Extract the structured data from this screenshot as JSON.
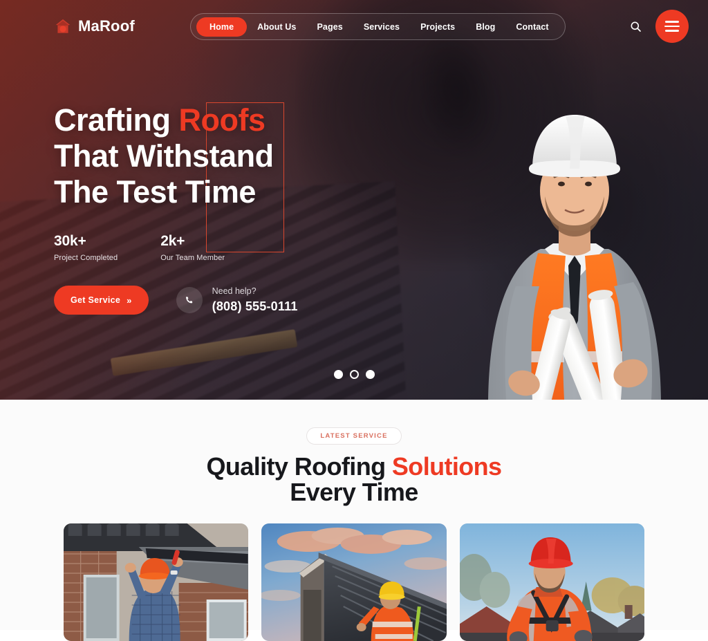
{
  "brand": {
    "name": "MaRoof",
    "icon": "home-roof-icon"
  },
  "nav": {
    "items": [
      {
        "label": "Home",
        "active": true
      },
      {
        "label": "About Us",
        "active": false
      },
      {
        "label": "Pages",
        "active": false
      },
      {
        "label": "Services",
        "active": false
      },
      {
        "label": "Projects",
        "active": false
      },
      {
        "label": "Blog",
        "active": false
      },
      {
        "label": "Contact",
        "active": false
      }
    ],
    "search_icon": "search-icon",
    "menu_icon": "hamburger-menu-icon"
  },
  "hero": {
    "title_line1_a": "Crafting ",
    "title_line1_b": "Roofs",
    "title_line2": "That Withstand",
    "title_line3": "The Test Time",
    "stats": [
      {
        "value": "30k+",
        "label": "Project Completed"
      },
      {
        "value": "2k+",
        "label": "Our Team Member"
      }
    ],
    "cta_label": "Get Service",
    "cta_chevron": "»",
    "phone_icon": "phone-icon",
    "need_help": "Need help?",
    "phone_number": "(808) 555-0111",
    "slides": [
      {
        "state": "filled"
      },
      {
        "state": "ring"
      },
      {
        "state": "filled"
      }
    ],
    "image_alt": "engineer-with-white-hardhat-orange-vest-holding-blueprints"
  },
  "services": {
    "badge": "LATEST SERVICE",
    "title_a": "Quality Roofing ",
    "title_b": "Solutions",
    "title_c": "Every Time",
    "cards": [
      {
        "alt": "worker-in-orange-hardhat-installing-gutter-on-brick-house"
      },
      {
        "alt": "roofer-in-yellow-hardhat-on-metal-roof-at-sunset"
      },
      {
        "alt": "roofer-in-red-hardhat-with-safety-harness-on-rooftop"
      }
    ]
  },
  "colors": {
    "accent": "#EE3A23",
    "hero_dark": "#2a2832",
    "hero_warm": "#6e2b25",
    "section_bg": "#fbfbfb",
    "heading": "#17181c"
  }
}
